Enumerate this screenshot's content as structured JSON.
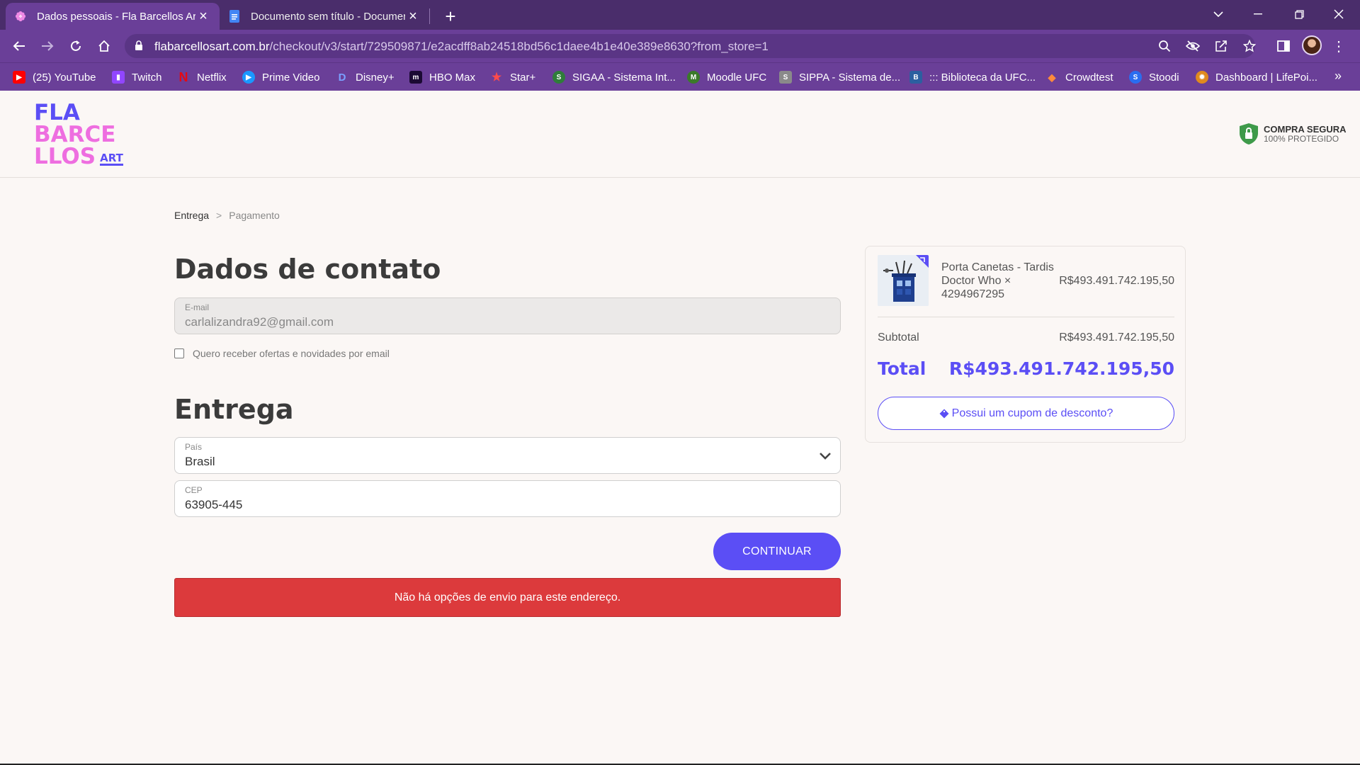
{
  "browser": {
    "tabs": [
      {
        "title": "Dados pessoais - Fla Barcellos Art",
        "active": true
      },
      {
        "title": "Documento sem título - Documentos Google",
        "active": false
      }
    ],
    "url_host": "flabarcellosart.com.br",
    "url_path": "/checkout/v3/start/729509871/e2acdff8ab24518bd56c1daee4b1e40e389e8630?from_store=1",
    "bookmarks": [
      {
        "label": "(25) YouTube",
        "icon": "youtube-icon",
        "color": "#ff0000"
      },
      {
        "label": "Twitch",
        "icon": "twitch-icon",
        "color": "#9146ff"
      },
      {
        "label": "Netflix",
        "icon": "netflix-icon",
        "color": "#e50914"
      },
      {
        "label": "Prime Video",
        "icon": "prime-video-icon",
        "color": "#1a98ff"
      },
      {
        "label": "Disney+",
        "icon": "disney-icon",
        "color": "#1e40c8"
      },
      {
        "label": "HBO Max",
        "icon": "hbo-max-icon",
        "color": "#2c0a5e"
      },
      {
        "label": "Star+",
        "icon": "star-plus-icon",
        "color": "#e23b3b"
      },
      {
        "label": "SIGAA - Sistema Int...",
        "icon": "sigaa-icon",
        "color": "#2f7d3a"
      },
      {
        "label": "Moodle UFC",
        "icon": "moodle-icon",
        "color": "#3b7a2a"
      },
      {
        "label": "SIPPA - Sistema de...",
        "icon": "sippa-icon",
        "color": "#7a7a7a"
      },
      {
        "label": "::: Biblioteca da UFC...",
        "icon": "biblioteca-icon",
        "color": "#2c5fa0"
      },
      {
        "label": "Crowdtest",
        "icon": "crowdtest-icon",
        "color": "#c4462c"
      },
      {
        "label": "Stoodi",
        "icon": "stoodi-icon",
        "color": "#2a6df0"
      },
      {
        "label": "Dashboard | LifePoi...",
        "icon": "lifepoints-icon",
        "color": "#e08a1e"
      }
    ]
  },
  "header": {
    "logo_lines": [
      "FLA",
      "BARCE",
      "LLOS",
      "ART"
    ],
    "secure_title": "COMPRA SEGURA",
    "secure_subtitle": "100% PROTEGIDO"
  },
  "breadcrumb": {
    "step1": "Entrega",
    "separator": ">",
    "step2": "Pagamento"
  },
  "contact": {
    "heading": "Dados de contato",
    "email_label": "E-mail",
    "email_value": "carlalizandra92@gmail.com",
    "newsletter_label": "Quero receber ofertas e novidades por email",
    "newsletter_checked": false
  },
  "delivery": {
    "heading": "Entrega",
    "country_label": "País",
    "country_value": "Brasil",
    "cep_label": "CEP",
    "cep_value": "63905-445",
    "continue_label": "CONTINUAR",
    "error_message": "Não há opções de envio para este endereço."
  },
  "summary": {
    "product_name": "Porta Canetas - Tardis Doctor Who × 4294967295",
    "product_price": "R$493.491.742.195,50",
    "subtotal_label": "Subtotal",
    "subtotal_value": "R$493.491.742.195,50",
    "total_label": "Total",
    "total_value": "R$493.491.742.195,50",
    "coupon_label": "Possui um cupom de desconto?"
  },
  "colors": {
    "brand_purple": "#5b4ef5",
    "brand_pink": "#ee6ee0",
    "error_red": "#dc3a3c",
    "chrome_purple": "#6a3f98"
  }
}
